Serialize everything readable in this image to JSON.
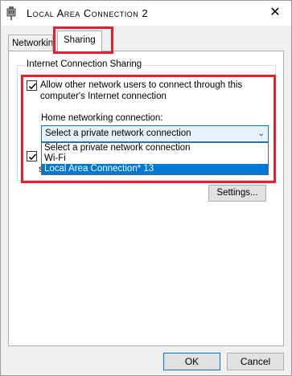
{
  "window": {
    "title": "Local Area Connection 2",
    "close_label": "✕"
  },
  "tabs": [
    {
      "label": "Networking"
    },
    {
      "label": "Sharing"
    }
  ],
  "sharing": {
    "group_title": "Internet Connection Sharing",
    "allow_checkbox": {
      "label": "Allow other network users to connect through this computer's Internet connection",
      "checked": true
    },
    "second_checkbox": {
      "checked": true
    },
    "home_label": "Home networking connection:",
    "combo_value": "Select a private network connection",
    "dropdown_options": [
      {
        "label": "Select a private network connection"
      },
      {
        "label": "Wi-Fi"
      },
      {
        "label": "Local Area Connection* 13"
      }
    ],
    "under_text": "s",
    "settings_label": "Settings..."
  },
  "footer": {
    "ok_label": "OK",
    "cancel_label": "Cancel"
  },
  "colors": {
    "accent": "#0078d7",
    "highlight": "#e5202f"
  }
}
